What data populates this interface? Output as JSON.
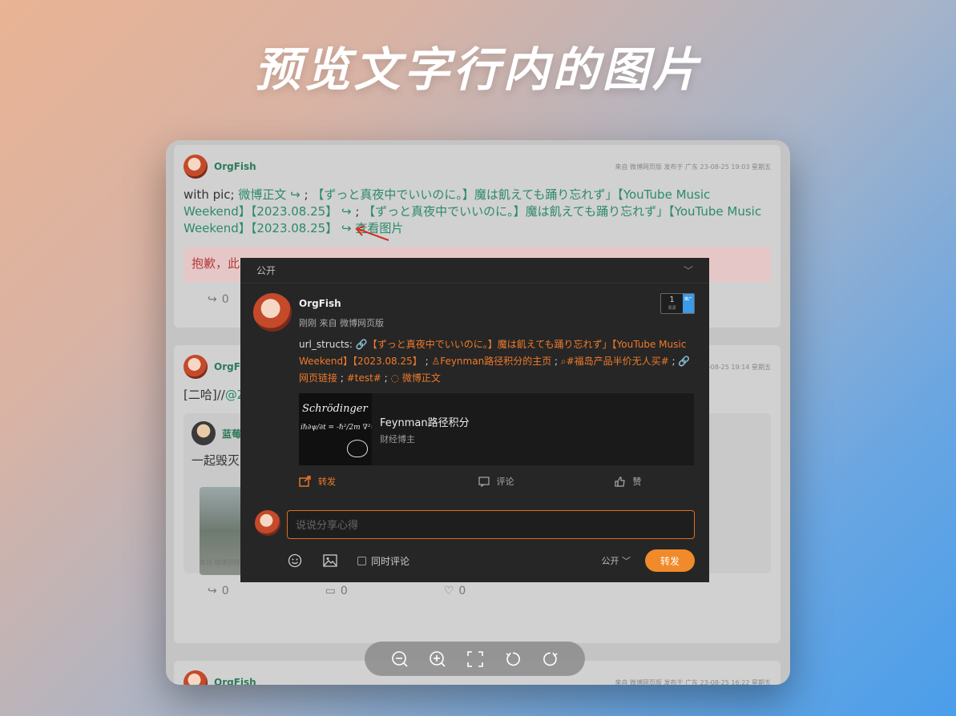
{
  "headline": "预览文字行内的图片",
  "feed": {
    "post1": {
      "author": "OrgFish",
      "meta": "来自 微博网页版   发布于 广东   23-08-25 19:03 星期五",
      "text_prefix": "with pic; ",
      "text_link1": "微博正文",
      "text_body": "【ずっと真夜中でいいのに。】魔は飢えても踊り忘れず」【YouTube Music Weekend】【2023.08.25】",
      "text_sep": " ; ",
      "text_body2": "【ずっと真夜中でいいのに。】魔は飢えても踊り忘れず」【YouTube Music Weekend】【2023.08.25】",
      "view_image": "查看图片",
      "notice": "抱歉，此",
      "repost_count": "0"
    },
    "post2": {
      "author": "OrgFish",
      "meta": "来自 微博网页版   23-08-25 19:14 星期五",
      "text_prefix": "[二哈]//",
      "text_mention": "@Z",
      "quote_author": "蓝莓",
      "quote_text": "一起毁灭",
      "quote_meta": "来自 微博视频号   发布于 江西   23-08-23 21:36 星期三",
      "repost_count": "0",
      "comment_count": "0",
      "like_count": "0"
    },
    "post3": {
      "author": "OrgFish",
      "meta": "来自 微博网页版   发布于 广东   23-08-25 16:22 星期五"
    }
  },
  "dialog": {
    "visibility_header": "公开",
    "author": "OrgFish",
    "sub": "刚刚  来自 微博网页版",
    "badge_num": "1",
    "badge_label": "周源",
    "badge_side": "推广",
    "body_label": "url_structs: ",
    "link1": "【ずっと真夜中でいいのに。】魔は飢えても踊り忘れず」【YouTube Music Weekend】【2023.08.25】",
    "link2": "Feynman路径积分的主页",
    "link3": "#福岛产品半价无人买#",
    "link4": "网页链接",
    "link5": "#test#",
    "link6": "微博正文",
    "sep": " ; ",
    "card_title": "Feynman路径积分",
    "card_sub": "财经博主",
    "card_thumb_line1": "Schrödinger",
    "card_thumb_line2": "iℏ∂ψ/∂t = -ℏ²/2m ∇²ψ+Vψ",
    "action_repost": "转发",
    "action_comment": "评论",
    "action_like": "赞",
    "compose_placeholder": "说说分享心得",
    "also_comment": "同时评论",
    "visibility": "公开",
    "send": "转发"
  },
  "colors": {
    "accent_orange": "#f07a2a",
    "link_green": "#2c8a6a",
    "dialog_bg": "#262626"
  }
}
